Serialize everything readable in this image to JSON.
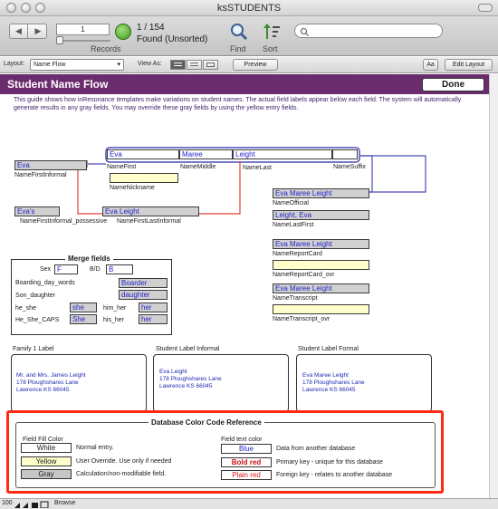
{
  "window": {
    "title": "ksSTUDENTS"
  },
  "toolbar": {
    "record_number": "1",
    "record_count": "1 / 154",
    "found_status": "Found (Unsorted)",
    "records_label": "Records",
    "find_label": "Find",
    "sort_label": "Sort"
  },
  "layoutbar": {
    "layout_label": "Layout:",
    "layout_value": "Name Flow",
    "view_as_label": "View As:",
    "preview_label": "Preview",
    "aa_label": "Aa",
    "edit_layout_label": "Edit Layout"
  },
  "header": {
    "title": "Student Name Flow",
    "done_label": "Done",
    "intro": "This guide shows how inResonance templates make variations on student names. The actual field labels appear below each field. The system will automatically generate results in any gray fields. You may override these gray fields by using the yellow entry fields."
  },
  "fields": {
    "name_first_informal": {
      "value": "Eva",
      "label": "NameFirstInformal"
    },
    "name_first": {
      "value": "Eva",
      "label": "NameFirst"
    },
    "name_middle": {
      "value": "Maree",
      "label": "NameMiddle"
    },
    "name_last": {
      "value": "Leight",
      "label": "NameLast"
    },
    "name_suffix": {
      "value": "",
      "label": "NameSuffix"
    },
    "name_nickname": {
      "value": "",
      "label": "NameNickname"
    },
    "name_first_informal_possessive": {
      "value": "Eva's",
      "label": "NameFirstInformal_possessive"
    },
    "name_first_last_informal": {
      "value": "Eva Leight",
      "label": "NameFirstLastInformal"
    },
    "name_official": {
      "value": "Eva Maree Leight",
      "label": "NameOfficial"
    },
    "name_last_first": {
      "value": "Leight, Eva",
      "label": "NameLastFirst"
    },
    "name_report_card": {
      "value": "Eva Maree Leight",
      "label": "NameReportCard"
    },
    "name_report_card_ovr": {
      "value": "",
      "label": "NameReportCard_ovr"
    },
    "name_transcript": {
      "value": "Eva Maree Leight",
      "label": "NameTranscript"
    },
    "name_transcript_ovr": {
      "value": "",
      "label": "NameTranscript_ovr"
    }
  },
  "merge": {
    "title": "Merge fields",
    "sex_label": "Sex",
    "sex_value": "F",
    "bd_label": "B/D",
    "bd_value": "B",
    "boarding_day_label": "Boarding_day_words",
    "boarding_day_value": "Boarder",
    "son_daughter_label": "Son_daughter",
    "son_daughter_value": "daughter",
    "he_she_label": "he_she",
    "he_she_value": "she",
    "him_her_label": "him_her",
    "him_her_value": "her",
    "he_she_caps_label": "He_She_CAPS",
    "he_she_caps_value": "She",
    "his_her_label": "his_her",
    "his_her_value": "her"
  },
  "labels": [
    {
      "title": "Family 1 Label",
      "lines": [
        "Mr. and Mrs. James Leight",
        "178 Ploughshares Lane",
        "Lawrence KS 66045"
      ]
    },
    {
      "title": "Student Label Informal",
      "lines": [
        "Eva Leight",
        "178 Ploughshares Lane",
        "Lawrence KS 66045"
      ]
    },
    {
      "title": "Student Label Formal",
      "lines": [
        "Eva Maree Leight",
        "178 Ploughshares Lane",
        "Lawrence KS 66045"
      ]
    }
  ],
  "reference": {
    "title": "Database Color Code Reference",
    "fill_header": "Field Fill Color",
    "fill_rows": [
      {
        "swatch": "White",
        "desc": "Normal entry."
      },
      {
        "swatch": "Yellow",
        "desc": "User Override. Use only if needed"
      },
      {
        "swatch": "Gray",
        "desc": "Calculation/non-modifiable field."
      }
    ],
    "text_header": "Field text color",
    "text_rows": [
      {
        "swatch": "Blue",
        "desc": "Data from another database"
      },
      {
        "swatch": "Bold red",
        "desc": "Primary key - unique for this database"
      },
      {
        "swatch": "Plain red",
        "desc": "Foreign key - relates to another database"
      }
    ]
  },
  "statusbar": {
    "zoom": "100",
    "mode": "Browse"
  },
  "colors": {
    "header_band": "#6b2c6d",
    "highlight_border": "#ff2a10",
    "field_text_blue": "#2424c8",
    "link_blue": "#4b4bb5",
    "link_red": "#e0403a"
  }
}
